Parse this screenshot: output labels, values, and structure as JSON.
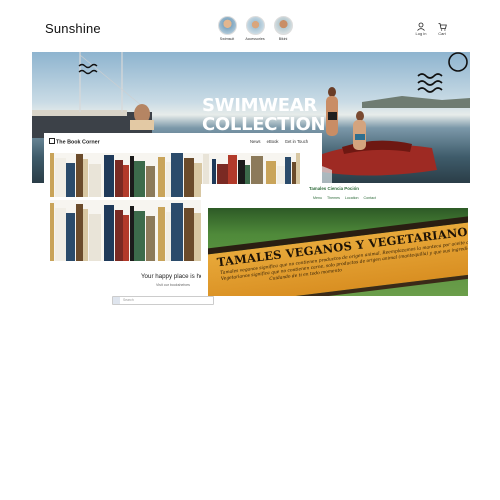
{
  "header": {
    "brand": "Sunshine",
    "categories": [
      {
        "label": "Swimsuit",
        "icon": "avatar-swimsuit"
      },
      {
        "label": "Accessories",
        "icon": "avatar-accessories"
      },
      {
        "label": "Bikini",
        "icon": "avatar-bikini"
      }
    ],
    "actions": [
      {
        "label": "Log in",
        "icon": "user-icon"
      },
      {
        "label": "Cart",
        "icon": "cart-icon"
      }
    ]
  },
  "hero": {
    "title_line1": "SWIMWEAR",
    "title_line2": "COLLECTION"
  },
  "book_corner": {
    "logo": "The Book Corner",
    "nav": [
      "News",
      "eBook",
      "Get in Touch"
    ],
    "tagline": "Your happy place is he",
    "link": "Visit our bookshelves",
    "search_placeholder": "Search"
  },
  "tamales": {
    "site_title": "Tamales Ciencia Poción",
    "nav": [
      "Menu",
      "Themes",
      "Location",
      "Contact"
    ],
    "sign_title": "TAMALES VEGANOS Y VEGETARIANOS",
    "sign_lines": [
      "Tamales veganos significa que no contienen productos de origen animal. Reemplazamos la manteca por aceite de oliva",
      "Vegetarianos significa que no contienen carne, solo productos de origen animal (mantequilla) y que sus ingredientes son vegetales",
      "Cuidando de ti en todo momento"
    ]
  },
  "colors": {
    "brand_text": "#111111",
    "tamales_green": "#2e6b3a",
    "sign_orange": "#e0982c"
  }
}
